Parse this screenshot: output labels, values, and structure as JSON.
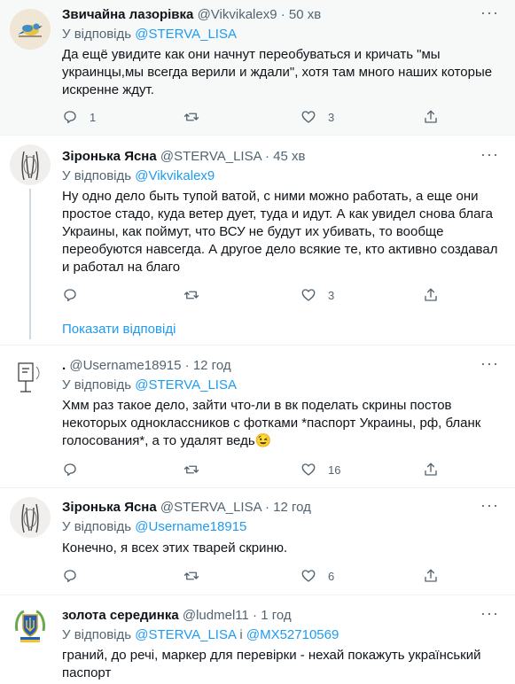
{
  "tweets": [
    {
      "name": "Звичайна лазорівка",
      "handle": "@Vikvikalex9",
      "time": "50 хв",
      "reply_prefix": "У відповідь",
      "reply_to": "@STERVA_LISA",
      "text": "Да ещё увидите как они начнут переобуваться и кричать \"мы украинцы,мы всегда верили и ждали\", хотя там много наших которые искренне ждут.",
      "replies": "1",
      "retweets": "",
      "likes": "3",
      "avatar": "bird-avatar"
    },
    {
      "name": "Зіронька Ясна",
      "handle": "@STERVA_LISA",
      "time": "45 хв",
      "reply_prefix": "У відповідь",
      "reply_to": "@Vikvikalex9",
      "text": "Ну одно дело быть тупой ватой, с ними можно работать, а еще они простое стадо, куда ветер дует, туда и идут. А как увидел снова блага Украины, как поймут, что ВСУ не будут их убивать, то вообще переобуются навсегда. А другое дело всякие те, кто активно создавал и работал на благо",
      "replies": "",
      "retweets": "",
      "likes": "3",
      "avatar": "sketch-avatar"
    },
    {
      "name": ".",
      "handle": "@Username18915",
      "time": "12 год",
      "reply_prefix": "У відповідь",
      "reply_to": "@STERVA_LISA",
      "text": "Хмм раз такое дело, зайти что-ли в вк поделать скрины постов некоторых одноклассников с фотками *паспорт Украины, рф, бланк голосования*, а то удалят ведь😉",
      "replies": "",
      "retweets": "",
      "likes": "16",
      "avatar": "doodle-avatar"
    },
    {
      "name": "Зіронька Ясна",
      "handle": "@STERVA_LISA",
      "time": "12 год",
      "reply_prefix": "У відповідь",
      "reply_to": "@Username18915",
      "text": "Конечно, я всех этих тварей скриню.",
      "replies": "",
      "retweets": "",
      "likes": "6",
      "avatar": "sketch-avatar"
    },
    {
      "name": "золота серединка",
      "handle": "@ludmel11",
      "time": "1 год",
      "reply_prefix": "У відповідь",
      "reply_to": "@STERVA_LISA",
      "reply_join": "і",
      "reply_to_2": "@MX52710569",
      "text": "граний, до речі, маркер для перевірки - нехай покажуть український паспорт",
      "avatar": "emblem-avatar"
    }
  ],
  "show_replies_label": "Показати відповіді",
  "sep_dot": "·",
  "more_label": "···",
  "colors": {
    "link": "#1d9bf0",
    "muted": "#536471",
    "text": "#0f1419",
    "highlight_bg": "#f7f9f9"
  }
}
